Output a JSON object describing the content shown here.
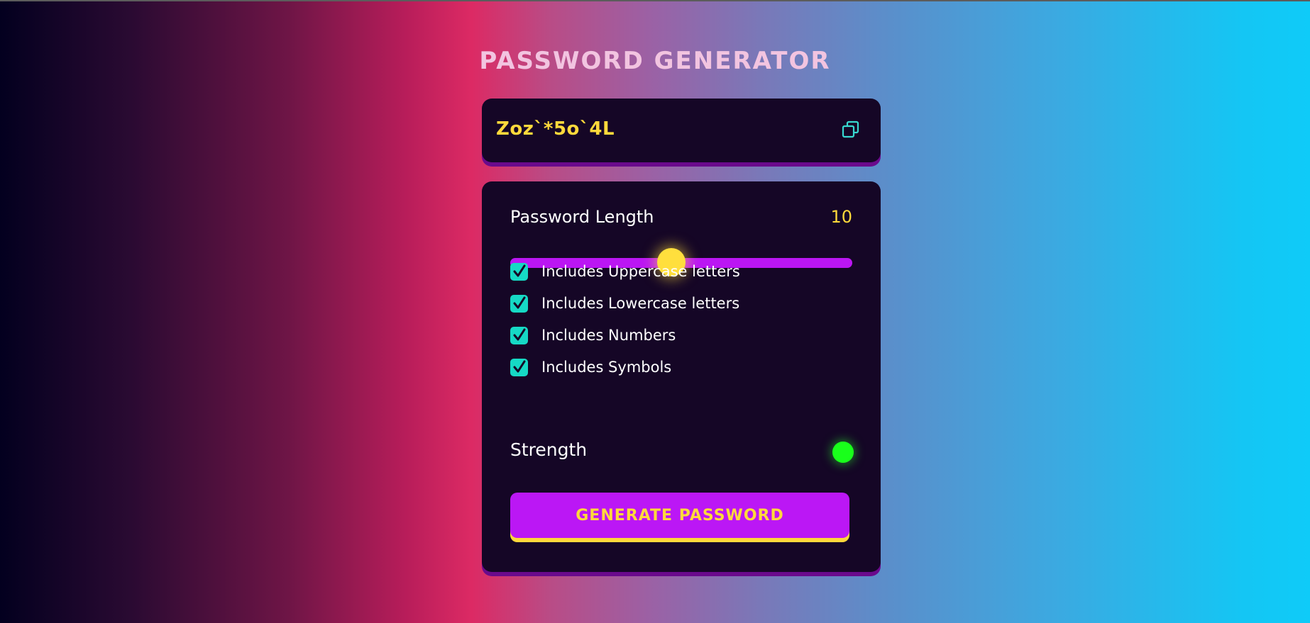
{
  "app": {
    "title": "PASSWORD GENERATOR"
  },
  "password": {
    "value": "Zoz`*5o`4L",
    "copy_icon": "copy-icon"
  },
  "length": {
    "label": "Password Length",
    "value": "10",
    "slider_fraction": 0.47
  },
  "options": [
    {
      "label": "Includes Uppercase letters",
      "checked": true
    },
    {
      "label": "Includes Lowercase letters",
      "checked": true
    },
    {
      "label": "Includes Numbers",
      "checked": true
    },
    {
      "label": "Includes Symbols",
      "checked": true
    }
  ],
  "strength": {
    "label": "Strength",
    "indicator_color": "#19ff1b"
  },
  "generate_button": {
    "label": "GENERATE PASSWORD"
  },
  "colors": {
    "accent_yellow": "#ffd93b",
    "accent_purple": "#bb16f3",
    "card_bg": "#150626",
    "checkbox_teal": "#16d9c5"
  }
}
